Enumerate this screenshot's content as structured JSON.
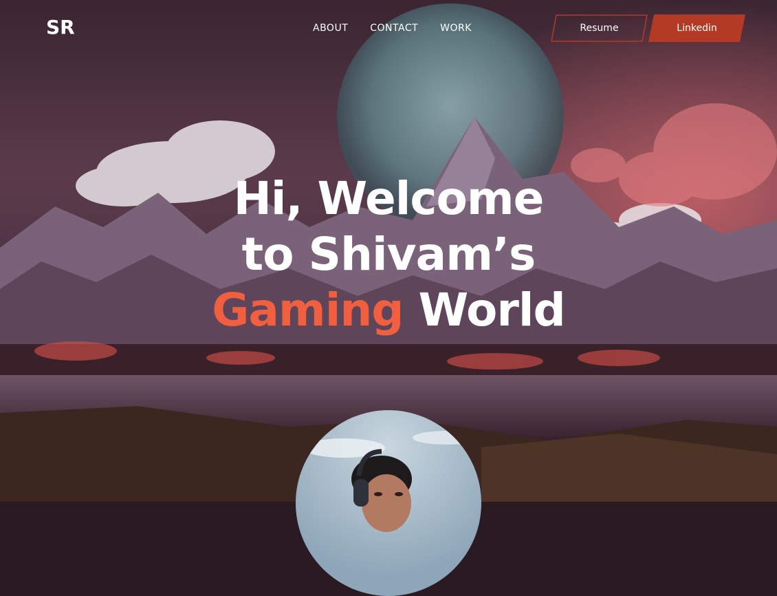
{
  "header": {
    "logo": "SR",
    "nav": [
      {
        "label": "ABOUT"
      },
      {
        "label": "CONTACT"
      },
      {
        "label": "WORK"
      }
    ],
    "resume_label": "Resume",
    "linkedin_label": "Linkedin"
  },
  "hero": {
    "line1": "Hi, Welcome",
    "line2": "to Shivam’s",
    "accent_word": "Gaming",
    "last_word": "World"
  },
  "colors": {
    "accent": "#f06040",
    "button": "#b33a24",
    "text": "#ffffff"
  },
  "icons": {
    "background": "mountain-landscape-illustration",
    "profile": "profile-photo-with-headphones"
  }
}
